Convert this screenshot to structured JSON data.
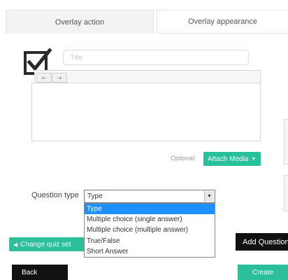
{
  "tabs": {
    "overlay_action": "Overlay action",
    "overlay_appearance": "Overlay appearance"
  },
  "question": {
    "title_placeholder": "Title",
    "checkbox_icon": "checkbox-checked-icon"
  },
  "editor": {
    "toolbar_buttons": [
      "bullet-list-icon",
      "numbered-list-icon"
    ]
  },
  "media": {
    "optional_label": "Optional:",
    "attach_label": "Attach Media"
  },
  "question_type": {
    "label": "Question type",
    "selected_value": "Type",
    "options": [
      "Type",
      "Multiple choice (single answer)",
      "Multiple choice (multiple answer)",
      "True/False",
      "Short Answer"
    ]
  },
  "actions": {
    "change_quiz_label": "Change quiz set",
    "add_question_label": "Add Question",
    "back_label": "Back",
    "create_label": "Create"
  },
  "colors": {
    "accent_green": "#26c09b",
    "dark_button": "#111111",
    "selected_option": "#1e90ff"
  }
}
